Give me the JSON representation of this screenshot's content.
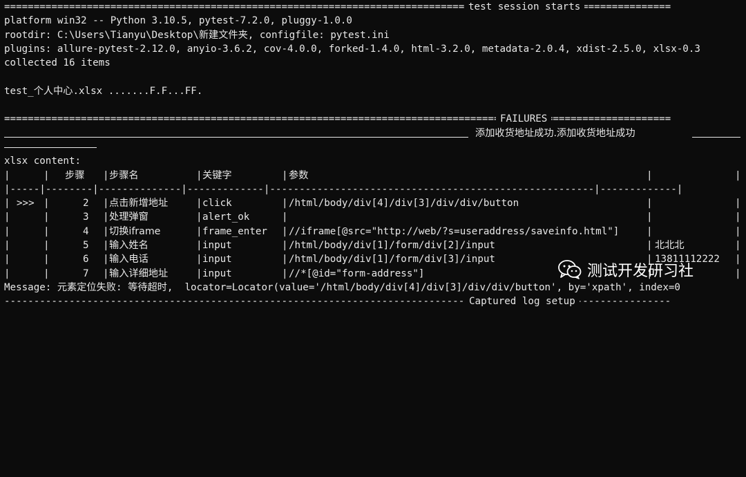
{
  "terminal": {
    "session_header": "test session starts",
    "platform_line": "platform win32 -- Python 3.10.5, pytest-7.2.0, pluggy-1.0.0",
    "rootdir_line": "rootdir: C:\\Users\\Tianyu\\Desktop\\新建文件夹, configfile: pytest.ini",
    "plugins_line": "plugins: allure-pytest-2.12.0, anyio-3.6.2, cov-4.0.0, forked-1.4.0, html-3.2.0, metadata-2.0.4, xdist-2.5.0, xlsx-0.3",
    "collected_line": "collected 16 items",
    "test_result_line": "test_个人中心.xlsx .......F.F...FF.",
    "failures_header": "FAILURES",
    "failure_title": "添加收货地址成功.添加收货地址成功",
    "xlsx_content_label": "xlsx content:",
    "table": {
      "headers": [
        "",
        "步骤",
        "步骤名",
        "关键字",
        "参数",
        ""
      ],
      "rows": [
        {
          "marker": ">>>",
          "step": "2",
          "name": "点击新增地址",
          "keyword": "click",
          "param": "/html/body/div[4]/div[3]/div/div/button",
          "value": ""
        },
        {
          "marker": "",
          "step": "3",
          "name": "处理弹窗",
          "keyword": "alert_ok",
          "param": "",
          "value": ""
        },
        {
          "marker": "",
          "step": "4",
          "name": "切换iframe",
          "keyword": "frame_enter",
          "param": "//iframe[@src=\"http://web/?s=useraddress/saveinfo.html\"]",
          "value": ""
        },
        {
          "marker": "",
          "step": "5",
          "name": "输入姓名",
          "keyword": "input",
          "param": "/html/body/div[1]/form/div[2]/input",
          "value": "北北北"
        },
        {
          "marker": "",
          "step": "6",
          "name": "输入电话",
          "keyword": "input",
          "param": "/html/body/div[1]/form/div[3]/input",
          "value": "13811112222"
        },
        {
          "marker": "",
          "step": "7",
          "name": "输入详细地址",
          "keyword": "input",
          "param": "//*[@id=\"form-address\"]",
          "value": ""
        }
      ]
    },
    "message_line": "Message: 元素定位失败: 等待超时,  locator=Locator(value='/html/body/div[4]/div[3]/div/div/button', by='xpath', index=0",
    "captured_header": "Captured log setup"
  },
  "watermark": {
    "icon": "wechat-icon",
    "text": "测试开发研习社"
  }
}
